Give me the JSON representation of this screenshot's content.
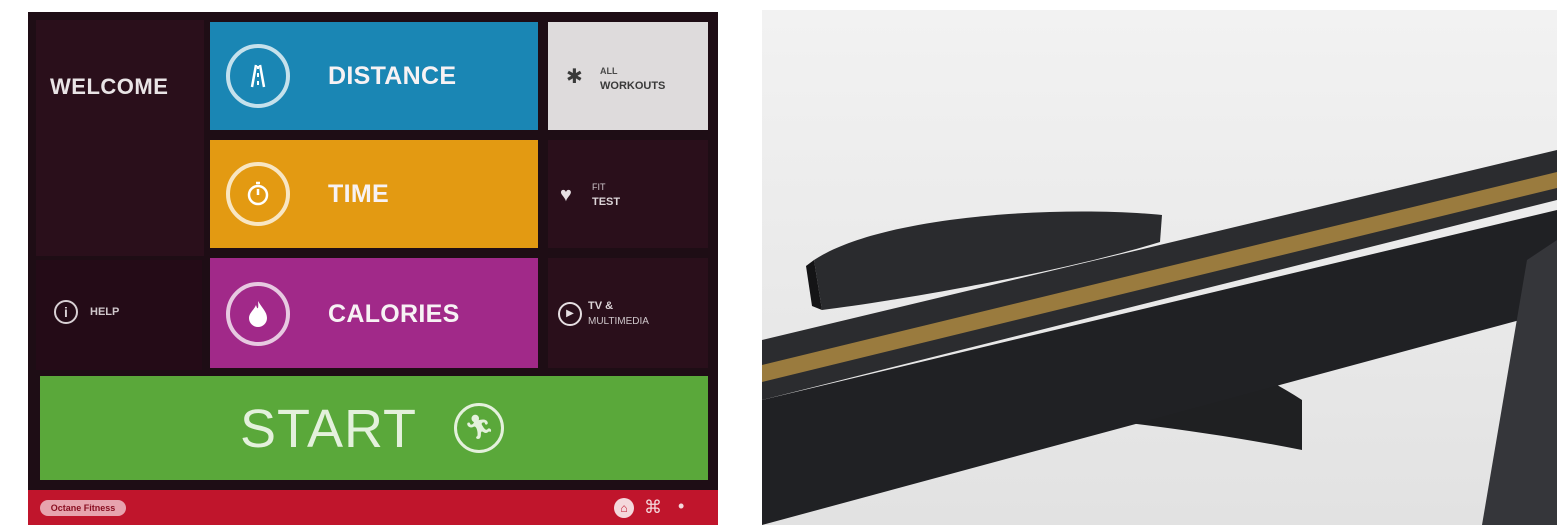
{
  "console": {
    "welcome": "WELCOME",
    "tiles": {
      "distance": "DISTANCE",
      "time": "TIME",
      "calories": "CALORIES",
      "all_workouts_line1": "ALL",
      "all_workouts_line2": "WORKOUTS",
      "fit_test_line1": "FIT",
      "fit_test_line2": "TEST",
      "tv_line1": "TV &",
      "tv_line2": "MULTIMEDIA",
      "help": "HELP"
    },
    "start_label": "START",
    "footer_brand": "Octane Fitness"
  },
  "colors": {
    "distance": "#1a86b4",
    "time": "#e39a12",
    "calories": "#a12989",
    "start": "#5aa83a",
    "footer": "#c0152c",
    "background": "#1e0d15"
  },
  "icons": {
    "distance": "road-icon",
    "time": "stopwatch-icon",
    "calories": "flame-icon",
    "all_workouts": "runner-icon",
    "fit_test": "heart-rate-icon",
    "tv": "play-icon",
    "help": "info-icon",
    "start": "running-man-icon",
    "footer_home": "home-icon",
    "footer_globe": "globe-icon",
    "footer_close": "close-icon"
  }
}
